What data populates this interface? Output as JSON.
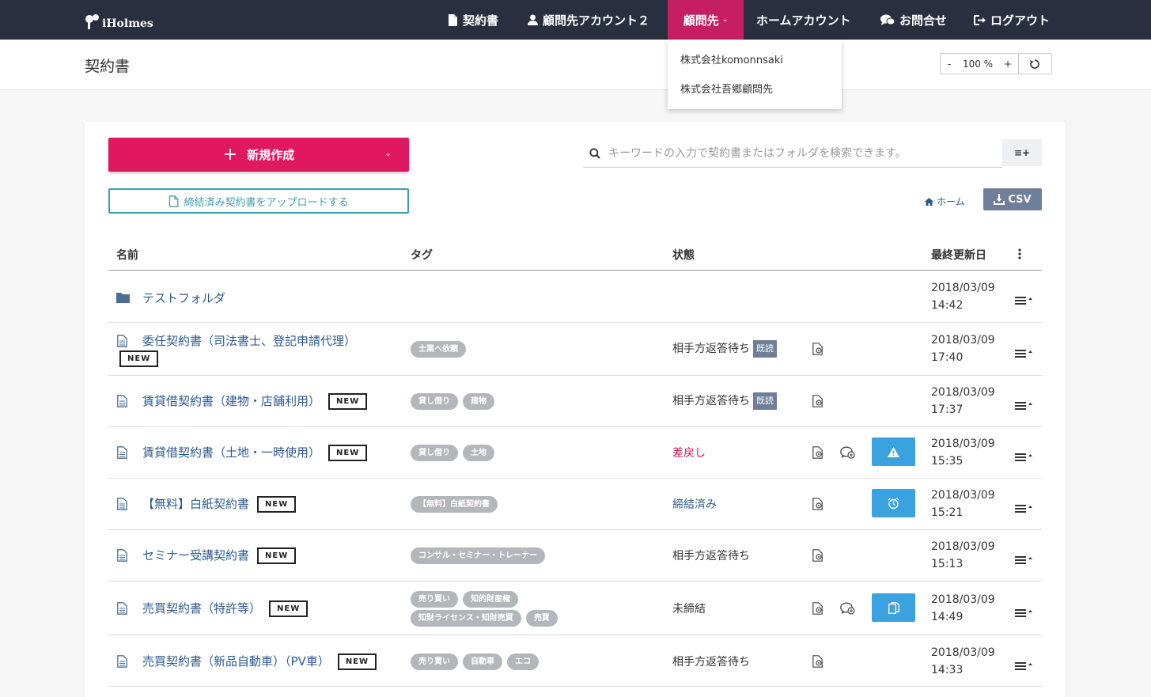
{
  "nav": {
    "logo": "iHolmes",
    "items": [
      "契約書",
      "顧問先アカウント２",
      "顧問先",
      "ホームアカウント",
      "お問合せ",
      "ログアウト"
    ],
    "dropdown": [
      "株式会社komonnsaki",
      "株式会社吾郷顧問先"
    ]
  },
  "header": {
    "title": "契約書",
    "zoom": {
      "minus": "-",
      "value": "100 %",
      "plus": "+"
    }
  },
  "toolbar": {
    "new_label": "新規作成",
    "upload_label": "締結済み契約書をアップロードする",
    "search_placeholder": "キーワードの入力で契約書またはフォルダを検索できます。",
    "filter_label": "≡+",
    "home_label": "ホーム",
    "csv_label": "CSV"
  },
  "table": {
    "columns": [
      "名前",
      "タグ",
      "状態",
      "最終更新日"
    ],
    "new_badge": "NEW",
    "read_badge": "既読",
    "rows": [
      {
        "type": "folder",
        "name": "テストフォルダ",
        "tags": [],
        "status": "",
        "date": "2018/03/09",
        "time": "14:42"
      },
      {
        "type": "doc",
        "name": "委任契約書（司法書士、登記申請代理）",
        "tags": [
          "士業へ依頼"
        ],
        "status": "相手方返答待ち",
        "date": "2018/03/09",
        "time": "17:40"
      },
      {
        "type": "doc",
        "name": "賃貸借契約書（建物・店舗利用）",
        "tags": [
          "貸し借り",
          "建物"
        ],
        "status": "相手方返答待ち",
        "date": "2018/03/09",
        "time": "17:37"
      },
      {
        "type": "doc",
        "name": "賃貸借契約書（土地・一時使用）",
        "tags": [
          "貸し借り",
          "土地"
        ],
        "status": "差戻し",
        "date": "2018/03/09",
        "time": "15:35"
      },
      {
        "type": "doc",
        "name": "【無料】白紙契約書",
        "tags": [
          "【無料】白紙契約書"
        ],
        "status": "締結済み",
        "date": "2018/03/09",
        "time": "15:21"
      },
      {
        "type": "doc",
        "name": "セミナー受講契約書",
        "tags": [
          "コンサル・セミナー・トレーナー"
        ],
        "status": "相手方返答待ち",
        "date": "2018/03/09",
        "time": "15:13"
      },
      {
        "type": "doc",
        "name": "売買契約書（特許等）",
        "tags": [
          "売り買い",
          "知的財産権",
          "知財ライセンス・知財売買",
          "売買"
        ],
        "status": "未締結",
        "date": "2018/03/09",
        "time": "14:49"
      },
      {
        "type": "doc",
        "name": "売買契約書（新品自動車）（PV車）",
        "tags": [
          "売り買い",
          "自動車",
          "エコ"
        ],
        "status": "相手方返答待ち",
        "date": "2018/03/09",
        "time": "14:33"
      }
    ]
  },
  "colors": {
    "navbar": "#28303f",
    "accent": "#e0185f",
    "link": "#2c5a8f",
    "teal": "#3da0b1",
    "action": "#3aa2df"
  },
  "icons": [
    "document-icon",
    "user-icon",
    "chat-icon",
    "logout-icon",
    "folder-icon",
    "search-icon",
    "home-icon",
    "download-icon",
    "reset-icon",
    "preview-icon",
    "comment-icon",
    "warning-icon",
    "alarm-icon",
    "copy-icon",
    "row-menu-icon",
    "more-vertical-icon"
  ]
}
